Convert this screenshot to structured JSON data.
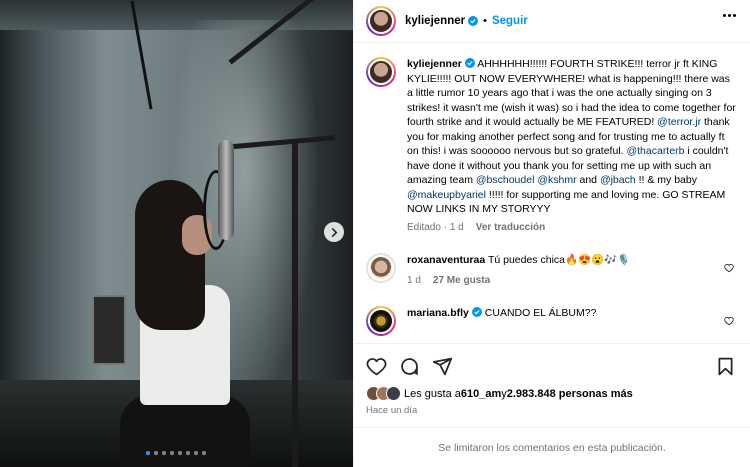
{
  "media": {
    "image_alt": "Woman singing into studio microphone in recording booth",
    "carousel_dots": 8,
    "active_dot": 0
  },
  "header": {
    "username": "kyliejenner",
    "separator": "•",
    "follow_label": "Seguir"
  },
  "caption": {
    "username": "kyliejenner",
    "segments": [
      {
        "t": "AHHHHHH!!!!!! FOURTH STRIKE!!! terror jr ft KING KYLIE!!!!! OUT NOW EVERYWHERE! what is happening!!! there was a little rumor 10 years ago that i was the one actually singing on 3 strikes! it wasn't me (wish it was) so i had the idea to come together for fourth strike and it would actually be ME FEATURED! ",
        "m": false
      },
      {
        "t": "@terror.jr",
        "m": true
      },
      {
        "t": " thank you for making another perfect song and for trusting me to actually ft on this! i was soooooo nervous but so grateful. ",
        "m": false
      },
      {
        "t": "@thacarterb",
        "m": true
      },
      {
        "t": " i couldn't have done it without you thank you for setting me up with such an amazing team ",
        "m": false
      },
      {
        "t": "@bschoudel",
        "m": true
      },
      {
        "t": " ",
        "m": false
      },
      {
        "t": "@kshmr",
        "m": true
      },
      {
        "t": " and ",
        "m": false
      },
      {
        "t": "@jbach",
        "m": true
      },
      {
        "t": " !! & my baby ",
        "m": false
      },
      {
        "t": "@makeupbyariel",
        "m": true
      },
      {
        "t": " !!!!! for supporting me and loving me. GO STREAM NOW LINKS IN MY STORYYY",
        "m": false
      }
    ],
    "edited": "Editado",
    "time": "1 d",
    "translate": "Ver traducción"
  },
  "comments": [
    {
      "username": "roxanaventuraa",
      "text": "Tú puedes chica🔥😍😮🎶🎙️",
      "time": "1 d",
      "likes": "27 Me gusta",
      "verified": false
    },
    {
      "username": "mariana.bfly",
      "text": "CUANDO EL ÁLBUM??",
      "time": "",
      "likes": "",
      "verified": true
    }
  ],
  "likes": {
    "prefix": "Les gusta a ",
    "user": "610_am",
    "mid": " y ",
    "count": "2.983.848 personas más"
  },
  "posted_ago": "Hace un día",
  "comments_disabled": "Se limitaron los comentarios en esta publicación.",
  "colors": {
    "accent": "#0095f6",
    "mention": "#00376b",
    "muted": "#737373",
    "verified": "#0095f6"
  }
}
